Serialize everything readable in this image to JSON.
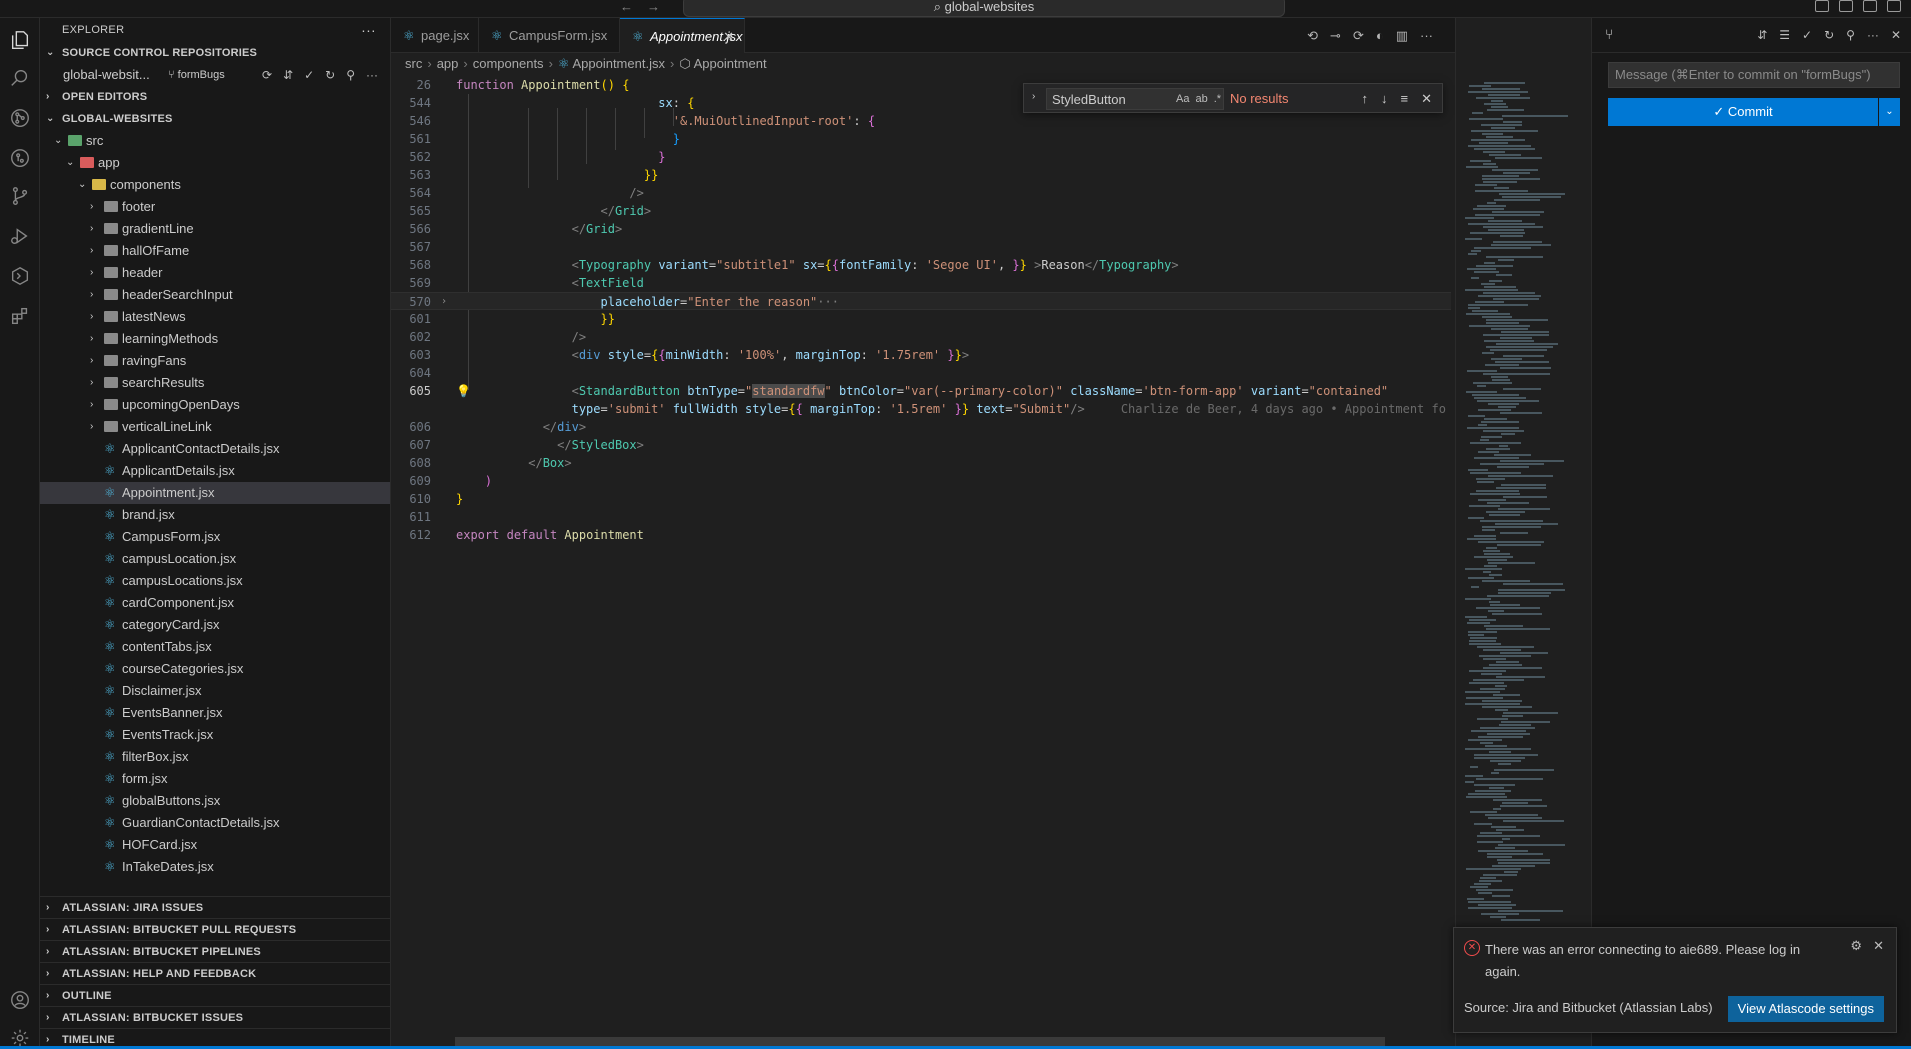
{
  "titlebar": {
    "search_text": "global-websites",
    "back": "←",
    "forward": "→"
  },
  "explorer": {
    "title": "EXPLORER",
    "scm_repos_header": "SOURCE CONTROL REPOSITORIES",
    "repo_name": "global-websit...",
    "repo_branch": "formBugs",
    "open_editors": "OPEN EDITORS",
    "workspace": "GLOBAL-WEBSITES",
    "tree": [
      {
        "name": "src",
        "depth": 1,
        "kind": "folder-src",
        "open": true
      },
      {
        "name": "app",
        "depth": 2,
        "kind": "folder-app",
        "open": true
      },
      {
        "name": "components",
        "depth": 3,
        "kind": "folder-components",
        "open": true
      },
      {
        "name": "footer",
        "depth": 4,
        "kind": "folder"
      },
      {
        "name": "gradientLine",
        "depth": 4,
        "kind": "folder"
      },
      {
        "name": "hallOfFame",
        "depth": 4,
        "kind": "folder"
      },
      {
        "name": "header",
        "depth": 4,
        "kind": "folder"
      },
      {
        "name": "headerSearchInput",
        "depth": 4,
        "kind": "folder"
      },
      {
        "name": "latestNews",
        "depth": 4,
        "kind": "folder"
      },
      {
        "name": "learningMethods",
        "depth": 4,
        "kind": "folder"
      },
      {
        "name": "ravingFans",
        "depth": 4,
        "kind": "folder"
      },
      {
        "name": "searchResults",
        "depth": 4,
        "kind": "folder"
      },
      {
        "name": "upcomingOpenDays",
        "depth": 4,
        "kind": "folder"
      },
      {
        "name": "verticalLineLink",
        "depth": 4,
        "kind": "folder"
      },
      {
        "name": "ApplicantContactDetails.jsx",
        "depth": 4,
        "kind": "file"
      },
      {
        "name": "ApplicantDetails.jsx",
        "depth": 4,
        "kind": "file"
      },
      {
        "name": "Appointment.jsx",
        "depth": 4,
        "kind": "file",
        "selected": true
      },
      {
        "name": "brand.jsx",
        "depth": 4,
        "kind": "file"
      },
      {
        "name": "CampusForm.jsx",
        "depth": 4,
        "kind": "file"
      },
      {
        "name": "campusLocation.jsx",
        "depth": 4,
        "kind": "file"
      },
      {
        "name": "campusLocations.jsx",
        "depth": 4,
        "kind": "file"
      },
      {
        "name": "cardComponent.jsx",
        "depth": 4,
        "kind": "file"
      },
      {
        "name": "categoryCard.jsx",
        "depth": 4,
        "kind": "file"
      },
      {
        "name": "contentTabs.jsx",
        "depth": 4,
        "kind": "file"
      },
      {
        "name": "courseCategories.jsx",
        "depth": 4,
        "kind": "file"
      },
      {
        "name": "Disclaimer.jsx",
        "depth": 4,
        "kind": "file"
      },
      {
        "name": "EventsBanner.jsx",
        "depth": 4,
        "kind": "file"
      },
      {
        "name": "EventsTrack.jsx",
        "depth": 4,
        "kind": "file"
      },
      {
        "name": "filterBox.jsx",
        "depth": 4,
        "kind": "file"
      },
      {
        "name": "form.jsx",
        "depth": 4,
        "kind": "file"
      },
      {
        "name": "globalButtons.jsx",
        "depth": 4,
        "kind": "file"
      },
      {
        "name": "GuardianContactDetails.jsx",
        "depth": 4,
        "kind": "file"
      },
      {
        "name": "HOFCard.jsx",
        "depth": 4,
        "kind": "file"
      },
      {
        "name": "InTakeDates.jsx",
        "depth": 4,
        "kind": "file"
      }
    ],
    "bottom_sections": [
      "ATLASSIAN: JIRA ISSUES",
      "ATLASSIAN: BITBUCKET PULL REQUESTS",
      "ATLASSIAN: BITBUCKET PIPELINES",
      "ATLASSIAN: HELP AND FEEDBACK",
      "OUTLINE",
      "ATLASSIAN: BITBUCKET ISSUES",
      "TIMELINE"
    ]
  },
  "tabs": [
    {
      "label": "page.jsx",
      "active": false
    },
    {
      "label": "CampusForm.jsx",
      "active": false
    },
    {
      "label": "Appointment.jsx",
      "active": true
    }
  ],
  "breadcrumb": [
    "src",
    "app",
    "components",
    "Appointment.jsx",
    "Appointment"
  ],
  "find": {
    "query": "StyledButton",
    "result": "No results",
    "opt_case": "Aa",
    "opt_word": "ab",
    "opt_regex": ".*"
  },
  "code": {
    "line_numbers": [
      "26",
      "544",
      "546",
      "561",
      "562",
      "563",
      "564",
      "565",
      "566",
      "567",
      "568",
      "569",
      "570",
      "601",
      "602",
      "603",
      "604",
      "605",
      "",
      "606",
      "607",
      "608",
      "609",
      "610",
      "611",
      "612"
    ],
    "blame": "Charlize de Beer, 4 days ago • Appointment fo"
  },
  "scm": {
    "commit_placeholder": "Message (⌘Enter to commit on \"formBugs\")",
    "commit_label": "Commit"
  },
  "notification": {
    "message": "There was an error connecting to aie689. Please log in again.",
    "source": "Source: Jira and Bitbucket (Atlassian Labs)",
    "button": "View Atlascode settings"
  },
  "colors": {
    "accent": "#0078d4",
    "error": "#f14c4c",
    "no_results": "#f48771"
  }
}
